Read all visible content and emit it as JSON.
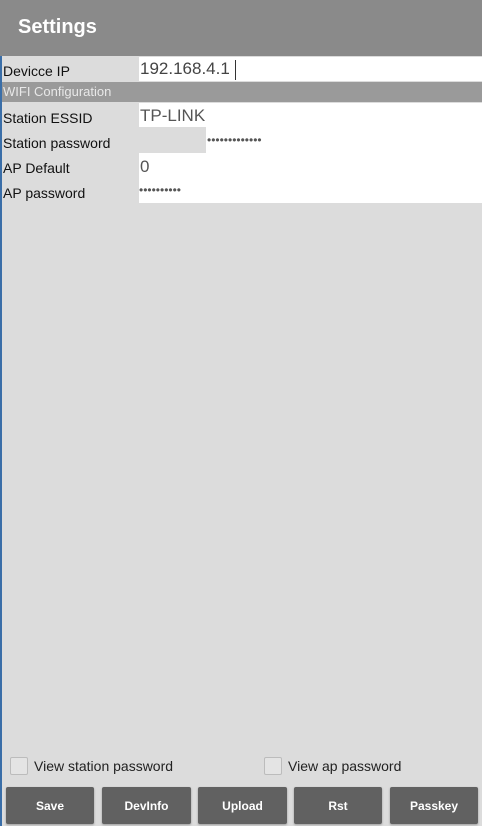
{
  "appbar": {
    "title": "Settings"
  },
  "device": {
    "label": "Devicce IP",
    "value": "192.168.4.1"
  },
  "wifi": {
    "header": "WIFI Configuration",
    "station_essid_label": "Station ESSID",
    "station_essid_value": "TP-LINK",
    "station_password_label": "Station password",
    "station_password_value": "•••••••••••••",
    "ap_default_label": "AP Default",
    "ap_default_value": "0",
    "ap_password_label": "AP password",
    "ap_password_value": "••••••••••"
  },
  "options": {
    "view_station_password": "View station password",
    "view_ap_password": "View ap password"
  },
  "buttons": {
    "save": "Save",
    "devinfo": "DevInfo",
    "upload": "Upload",
    "rst": "Rst",
    "passkey": "Passkey"
  },
  "colors": {
    "appbar": "#8a8a8a",
    "section_header": "#9a9a9a",
    "background": "#dcdcdc",
    "button": "#616161"
  }
}
